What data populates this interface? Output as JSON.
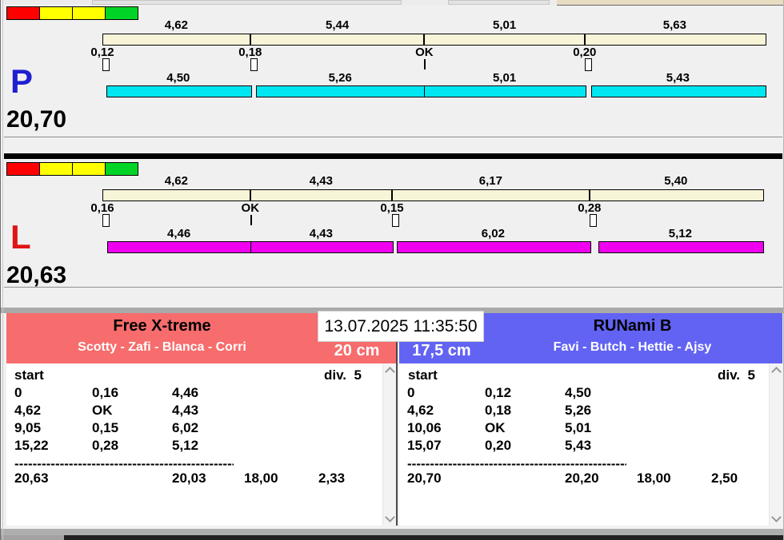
{
  "datetime": "13.07.2025 11:35:50",
  "colors": {
    "background": "#f0f0f0",
    "split_bar": "#f8f4d8",
    "lane_p_bar": "#00e7f2",
    "lane_l_bar": "#ef00ef",
    "left_header": "#f76c6c",
    "right_header": "#6263f3",
    "legend": [
      "#ff0000",
      "#ffff00",
      "#ffff00",
      "#00d427"
    ],
    "letter_p": "#1f1fd0",
    "letter_l": "#e01414"
  },
  "lanes": [
    {
      "letter": "P",
      "letter_color": "#1f1fd0",
      "total": "20,70",
      "bar_color": "#00e7f2",
      "segments": [
        {
          "split_label": "4,62",
          "split": 4.62,
          "marker_label": "0,12",
          "marker": 0.12,
          "run_label": "4,50",
          "run": 4.5
        },
        {
          "split_label": "5,44",
          "split": 5.44,
          "marker_label": "0,18",
          "marker": 0.18,
          "run_label": "5,26",
          "run": 5.26
        },
        {
          "split_label": "5,01",
          "split": 5.01,
          "marker_label": "OK",
          "marker": 0,
          "run_label": "5,01",
          "run": 5.01
        },
        {
          "split_label": "5,63",
          "split": 5.63,
          "marker_label": "0,20",
          "marker": 0.2,
          "run_label": "5,43",
          "run": 5.43
        }
      ]
    },
    {
      "letter": "L",
      "letter_color": "#e01414",
      "total": "20,63",
      "bar_color": "#ef00ef",
      "segments": [
        {
          "split_label": "4,62",
          "split": 4.62,
          "marker_label": "0,16",
          "marker": 0.16,
          "run_label": "4,46",
          "run": 4.46
        },
        {
          "split_label": "4,43",
          "split": 4.43,
          "marker_label": "OK",
          "marker": 0,
          "run_label": "4,43",
          "run": 4.43
        },
        {
          "split_label": "6,17",
          "split": 6.17,
          "marker_label": "0,15",
          "marker": 0.15,
          "run_label": "6,02",
          "run": 6.02
        },
        {
          "split_label": "5,40",
          "split": 5.4,
          "marker_label": "0,28",
          "marker": 0.28,
          "run_label": "5,12",
          "run": 5.12
        }
      ]
    }
  ],
  "panels": [
    {
      "team": "Free X-treme",
      "dogs": "Scotty - Zafi - Blanca - Corri",
      "height_label": "20 cm",
      "header_color": "#f76c6c",
      "table": {
        "start_label": "start",
        "div_label": "div.  5",
        "rows": [
          [
            "0",
            "0,16",
            "4,46"
          ],
          [
            "4,62",
            "OK",
            "4,43"
          ],
          [
            "9,05",
            "0,15",
            "6,02"
          ],
          [
            "15,22",
            "0,28",
            "5,12"
          ]
        ],
        "separator": "------------------------------------------------------------",
        "totals": [
          "20,63",
          "20,03",
          "18,00",
          "2,33"
        ]
      }
    },
    {
      "team": "RUNami B",
      "dogs": "Favi - Butch - Hettie - Ajsy",
      "height_label": "17,5 cm",
      "header_color": "#6263f3",
      "table": {
        "start_label": "start",
        "div_label": "div.  5",
        "rows": [
          [
            "0",
            "0,12",
            "4,50"
          ],
          [
            "4,62",
            "0,18",
            "5,26"
          ],
          [
            "10,06",
            "OK",
            "5,01"
          ],
          [
            "15,07",
            "0,20",
            "5,43"
          ]
        ],
        "separator": "------------------------------------------------------------",
        "totals": [
          "20,70",
          "20,20",
          "18,00",
          "2,50"
        ]
      }
    }
  ]
}
